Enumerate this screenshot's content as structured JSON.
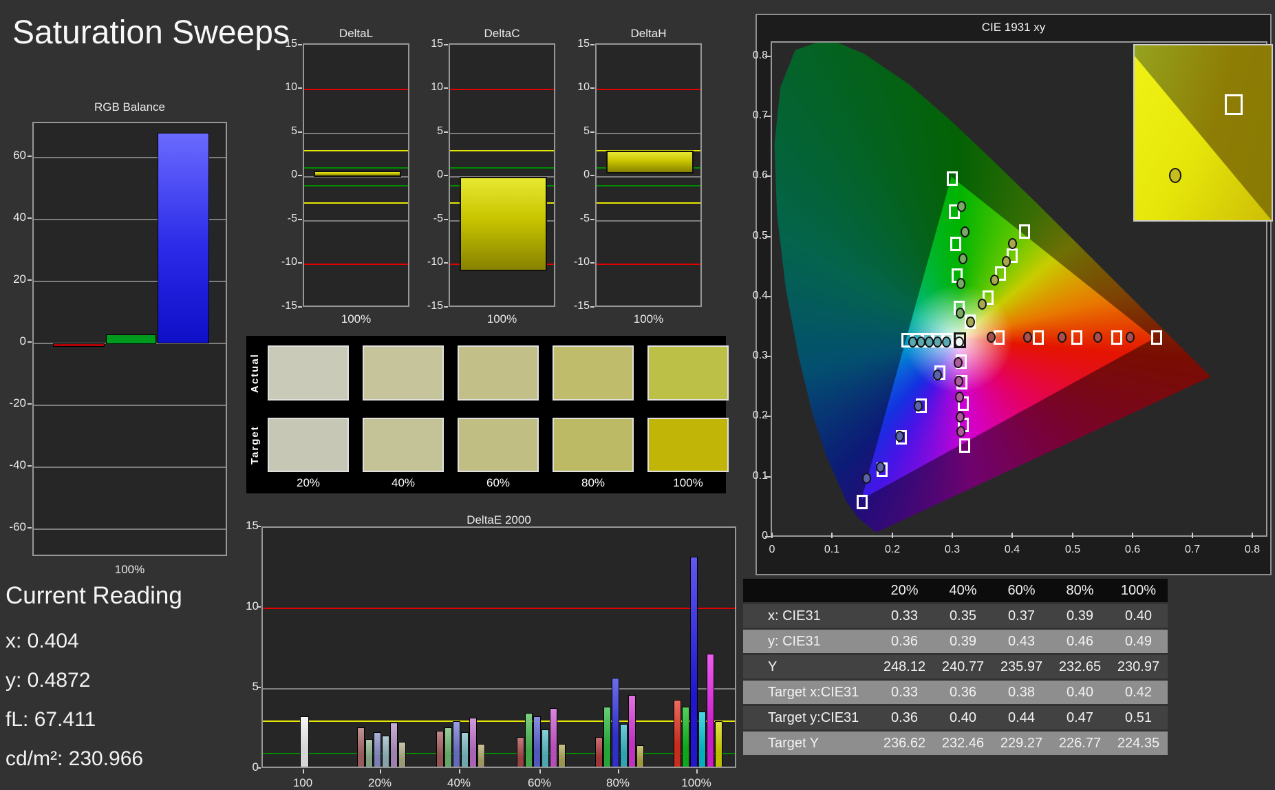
{
  "page": {
    "title": "Saturation Sweeps"
  },
  "rgb_balance": {
    "title": "RGB Balance",
    "x_label": "100%",
    "y_ticks": [
      60,
      40,
      20,
      0,
      -20,
      -40,
      -60
    ],
    "bars": [
      {
        "name": "red",
        "value": -1,
        "color": "#b40000"
      },
      {
        "name": "green",
        "value": 3,
        "color": "#009a1e"
      },
      {
        "name": "blue",
        "value": 68,
        "color": "#2a2ae8"
      }
    ]
  },
  "delta_charts": {
    "y_ticks": [
      15,
      10,
      5,
      0,
      -5,
      -10,
      -15
    ],
    "ref_lines": {
      "red": 10,
      "yellow": 3,
      "green": 1
    },
    "x_label": "100%",
    "charts": [
      {
        "title": "DeltaL",
        "bar_from": 0,
        "bar_to": 0.7
      },
      {
        "title": "DeltaC",
        "bar_from": -10.8,
        "bar_to": 0
      },
      {
        "title": "DeltaH",
        "bar_from": 0.4,
        "bar_to": 3.0
      }
    ]
  },
  "swatches": {
    "row_labels": [
      "Actual",
      "Target"
    ],
    "col_labels": [
      "20%",
      "40%",
      "60%",
      "80%",
      "100%"
    ],
    "actual": [
      "#cacab8",
      "#c6c49b",
      "#c2c088",
      "#bfbc6c",
      "#bdc046"
    ],
    "target": [
      "#c7c7b5",
      "#c4c297",
      "#c0be83",
      "#bcba64",
      "#c1b608"
    ]
  },
  "deltae2000": {
    "title": "DeltaE 2000",
    "y_ticks": [
      0,
      5,
      10,
      15
    ],
    "ref_lines": {
      "red": 10,
      "yellow": 3,
      "green": 1
    },
    "groups": [
      {
        "label": "100",
        "values": [
          3.3
        ],
        "colors": [
          "#f2f2f2"
        ]
      },
      {
        "label": "20%",
        "values": [
          2.6,
          1.9,
          2.3,
          2.1,
          2.9,
          1.7
        ],
        "colors": [
          "#aa6868",
          "#8fb48f",
          "#8b92ca",
          "#96b9c2",
          "#b491c6",
          "#b2ae86"
        ]
      },
      {
        "label": "40%",
        "values": [
          2.4,
          2.6,
          3.0,
          2.3,
          3.2,
          1.6
        ],
        "colors": [
          "#a85c5c",
          "#74ba74",
          "#7279d2",
          "#7fbdc5",
          "#bf72cc",
          "#b2aa70"
        ]
      },
      {
        "label": "60%",
        "values": [
          2.0,
          3.5,
          3.3,
          2.5,
          3.8,
          1.6
        ],
        "colors": [
          "#a84a4a",
          "#4cbc54",
          "#5a64d6",
          "#58bdc9",
          "#cc5ad0",
          "#b0a85a"
        ]
      },
      {
        "label": "80%",
        "values": [
          2.0,
          3.9,
          5.7,
          2.8,
          4.6,
          1.5
        ],
        "colors": [
          "#b23c3c",
          "#2cba40",
          "#3636e2",
          "#34bac9",
          "#d83ad8",
          "#b4ae48"
        ]
      },
      {
        "label": "100%",
        "values": [
          4.3,
          3.9,
          13.2,
          3.6,
          7.2,
          3.0
        ],
        "colors": [
          "#e23222",
          "#12bc20",
          "#2419ee",
          "#06c6d6",
          "#e520e5",
          "#d6d600"
        ]
      }
    ]
  },
  "cie": {
    "title": "CIE 1931 xy",
    "x_ticks": [
      "0",
      "0.1",
      "0.2",
      "0.3",
      "0.4",
      "0.5",
      "0.6",
      "0.7",
      "0.8"
    ],
    "y_ticks": [
      "0",
      "0.1",
      "0.2",
      "0.3",
      "0.4",
      "0.5",
      "0.6",
      "0.7",
      "0.8"
    ],
    "white_point": {
      "target": [
        0.3127,
        0.329
      ],
      "measured": [
        0.311,
        0.327
      ],
      "dot_color": "#f4f4f4"
    },
    "arms": [
      {
        "name": "red",
        "dot_color": "#aa4e4e",
        "targets": [
          [
            0.378,
            0.334
          ],
          [
            0.443,
            0.334
          ],
          [
            0.508,
            0.334
          ],
          [
            0.574,
            0.334
          ],
          [
            0.64,
            0.334
          ]
        ],
        "measured": [
          [
            0.365,
            0.334
          ],
          [
            0.425,
            0.334
          ],
          [
            0.483,
            0.334
          ],
          [
            0.542,
            0.334
          ],
          [
            0.596,
            0.334
          ]
        ]
      },
      {
        "name": "green",
        "dot_color": "#78aa64",
        "targets": [
          [
            0.311,
            0.383
          ],
          [
            0.308,
            0.437
          ],
          [
            0.306,
            0.49
          ],
          [
            0.303,
            0.544
          ],
          [
            0.3,
            0.598
          ]
        ],
        "measured": [
          [
            0.313,
            0.375
          ],
          [
            0.314,
            0.424
          ],
          [
            0.318,
            0.465
          ],
          [
            0.321,
            0.51
          ],
          [
            0.316,
            0.552
          ]
        ]
      },
      {
        "name": "blue",
        "dot_color": "#5a64aa",
        "targets": [
          [
            0.28,
            0.275
          ],
          [
            0.248,
            0.221
          ],
          [
            0.215,
            0.168
          ],
          [
            0.183,
            0.114
          ],
          [
            0.15,
            0.06
          ]
        ],
        "measured": [
          [
            0.276,
            0.272
          ],
          [
            0.243,
            0.22
          ],
          [
            0.212,
            0.17
          ],
          [
            0.18,
            0.118
          ],
          [
            0.158,
            0.1
          ]
        ]
      },
      {
        "name": "cyan",
        "dot_color": "#5aa8b0",
        "targets": [
          [
            0.293,
            0.329
          ],
          [
            0.276,
            0.329
          ],
          [
            0.259,
            0.329
          ],
          [
            0.242,
            0.329
          ],
          [
            0.225,
            0.329
          ]
        ],
        "measured": [
          [
            0.29,
            0.326
          ],
          [
            0.276,
            0.326
          ],
          [
            0.262,
            0.326
          ],
          [
            0.248,
            0.326
          ],
          [
            0.234,
            0.326
          ]
        ]
      },
      {
        "name": "magenta",
        "dot_color": "#b05a9e",
        "targets": [
          [
            0.315,
            0.294
          ],
          [
            0.316,
            0.259
          ],
          [
            0.318,
            0.224
          ],
          [
            0.319,
            0.189
          ],
          [
            0.321,
            0.154
          ]
        ],
        "measured": [
          [
            0.31,
            0.292
          ],
          [
            0.311,
            0.261
          ],
          [
            0.312,
            0.235
          ],
          [
            0.313,
            0.202
          ],
          [
            0.314,
            0.178
          ]
        ]
      },
      {
        "name": "yellow",
        "dot_color": "#a8a850",
        "targets": [
          [
            0.33,
            0.36
          ],
          [
            0.36,
            0.4
          ],
          [
            0.38,
            0.44
          ],
          [
            0.4,
            0.47
          ],
          [
            0.42,
            0.51
          ]
        ],
        "measured": [
          [
            0.33,
            0.36
          ],
          [
            0.35,
            0.39
          ],
          [
            0.37,
            0.43
          ],
          [
            0.39,
            0.46
          ],
          [
            0.4,
            0.49
          ]
        ]
      }
    ],
    "inset": {
      "square_pos": [
        66,
        28
      ],
      "dot_pos": [
        25,
        70
      ],
      "dot_color": "#c6be1e"
    }
  },
  "table": {
    "columns": [
      "20%",
      "40%",
      "60%",
      "80%",
      "100%"
    ],
    "rows": [
      {
        "label": "x: CIE31",
        "values": [
          "0.33",
          "0.35",
          "0.37",
          "0.39",
          "0.40"
        ]
      },
      {
        "label": "y: CIE31",
        "values": [
          "0.36",
          "0.39",
          "0.43",
          "0.46",
          "0.49"
        ]
      },
      {
        "label": "Y",
        "values": [
          "248.12",
          "240.77",
          "235.97",
          "232.65",
          "230.97"
        ]
      },
      {
        "label": "Target x:CIE31",
        "values": [
          "0.33",
          "0.36",
          "0.38",
          "0.40",
          "0.42"
        ]
      },
      {
        "label": "Target y:CIE31",
        "values": [
          "0.36",
          "0.40",
          "0.44",
          "0.47",
          "0.51"
        ]
      },
      {
        "label": "Target Y",
        "values": [
          "236.62",
          "232.46",
          "229.27",
          "226.77",
          "224.35"
        ]
      }
    ]
  },
  "current_reading": {
    "title": "Current Reading",
    "lines": [
      "x: 0.404",
      "y: 0.4872",
      "fL: 67.411",
      "cd/m²: 230.966"
    ]
  }
}
